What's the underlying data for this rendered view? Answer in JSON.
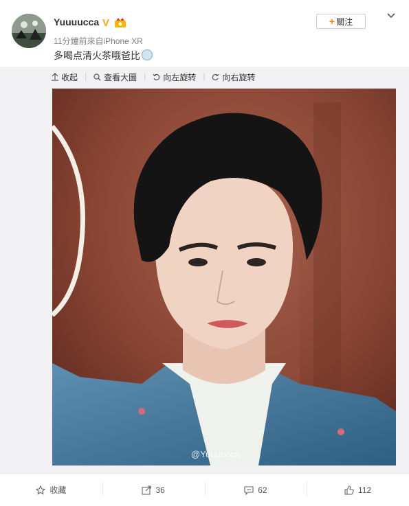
{
  "post": {
    "username": "Yuuuucca",
    "v_badge": "V",
    "meta": "11分鐘前來自iPhone XR",
    "text": "多喝点清火茶哦爸比",
    "follow_plus": "+",
    "follow_label": "關注"
  },
  "toolbar": {
    "collapse": "收起",
    "view_large": "查看大圖",
    "rotate_left": "向左旋转",
    "rotate_right": "向右旋转"
  },
  "image": {
    "watermark": "@Yuuuucca"
  },
  "footer": {
    "favorite": "收藏",
    "repost_count": "36",
    "comment_count": "62",
    "like_count": "112"
  },
  "colors": {
    "accent": "#ff8200",
    "badge": "#f5a623",
    "panel_bg": "#f2f2f5"
  }
}
